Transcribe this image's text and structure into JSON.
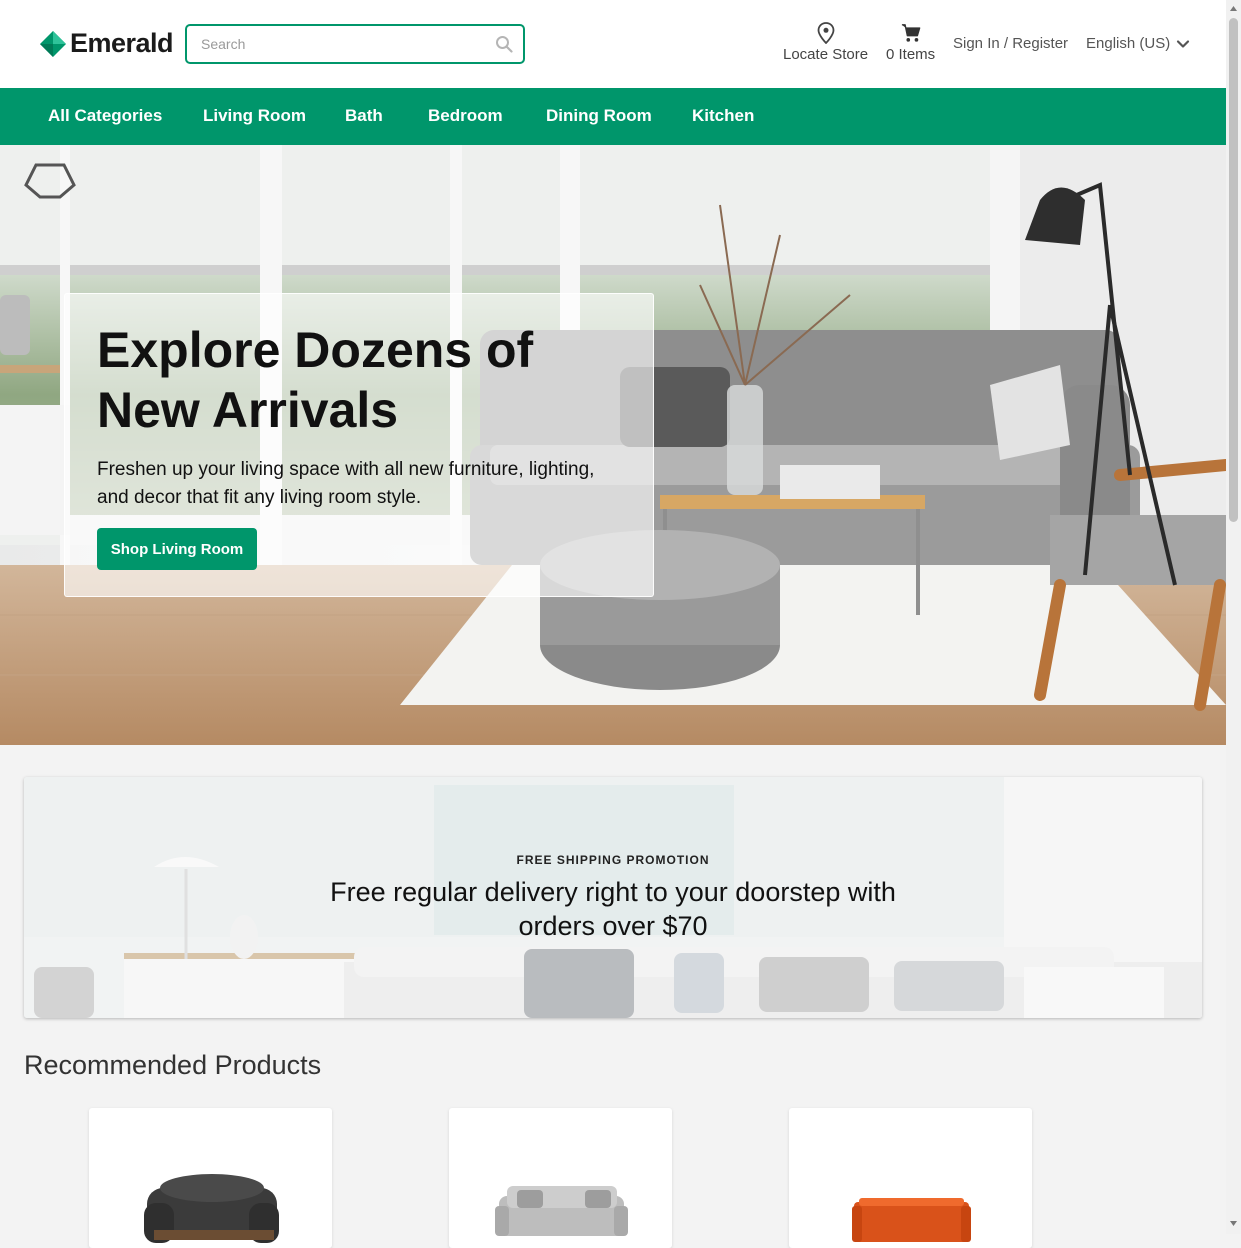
{
  "header": {
    "brand": "Emerald",
    "search_placeholder": "Search",
    "locate_label": "Locate Store",
    "cart_label": "0 Items",
    "signin_label": "Sign In / Register",
    "language_label": "English (US)"
  },
  "nav": {
    "items": [
      "All Categories",
      "Living Room",
      "Bath",
      "Bedroom",
      "Dining Room",
      "Kitchen"
    ]
  },
  "hero": {
    "title": "Explore Dozens of New Arrivals",
    "subtitle": "Freshen up your living space with all new furniture, lighting, and decor that fit any living room style.",
    "button_label": "Shop Living Room"
  },
  "promo": {
    "eyebrow": "FREE SHIPPING PROMOTION",
    "text": "Free regular delivery right to your doorstep with orders over $70"
  },
  "recommended": {
    "title": "Recommended Products"
  },
  "colors": {
    "accent": "#00966b",
    "page_background": "#f3f3f3"
  },
  "icons": [
    "emerald-logo-icon",
    "search-icon",
    "location-pin-icon",
    "cart-icon",
    "chevron-down-icon"
  ]
}
